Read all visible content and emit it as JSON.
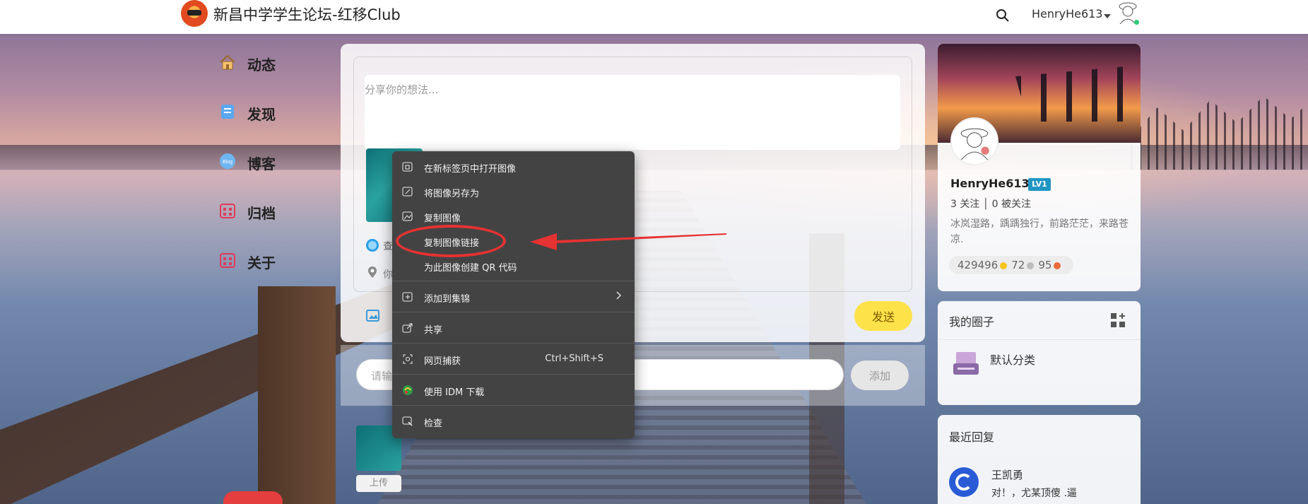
{
  "header": {
    "site_title": "新昌中学学生论坛-红移Club",
    "username": "HenryHe613"
  },
  "nav": {
    "items": [
      {
        "label": "动态",
        "icon": "home-icon"
      },
      {
        "label": "发现",
        "icon": "discover-icon"
      },
      {
        "label": "博客",
        "icon": "blog-icon"
      },
      {
        "label": "归档",
        "icon": "archive-icon"
      },
      {
        "label": "关于",
        "icon": "about-icon"
      }
    ]
  },
  "composer": {
    "placeholder": "分享你的想法...",
    "visibility_text": "查",
    "location_text": "你",
    "send_label": "发送"
  },
  "tags": {
    "input_placeholder": "请输",
    "add_label": "添加"
  },
  "post": {
    "upload_label": "上传"
  },
  "context_menu": {
    "items": [
      {
        "label": "在新标签页中打开图像",
        "icon": "open-tab-icon"
      },
      {
        "label": "将图像另存为",
        "icon": "save-image-icon"
      },
      {
        "label": "复制图像",
        "icon": "copy-image-icon"
      },
      {
        "label": "复制图像链接",
        "icon": ""
      },
      {
        "label": "为此图像创建 QR 代码",
        "icon": ""
      },
      {
        "label": "添加到集锦",
        "icon": "collection-icon"
      },
      {
        "label": "共享",
        "icon": "share-icon"
      },
      {
        "label": "网页捕获",
        "icon": "capture-icon",
        "shortcut": "Ctrl+Shift+S"
      },
      {
        "label": "使用 IDM 下载",
        "icon": "idm-icon"
      },
      {
        "label": "检查",
        "icon": "inspect-icon"
      }
    ],
    "highlighted": "复制图像链接"
  },
  "profile": {
    "name": "HenryHe613",
    "level": "LV1",
    "follow_text": "3 关注 │ 0 被关注",
    "bio": "冰岚湿路，踽踽独行，前路茫茫，来路苍凉.",
    "stats": [
      "429496",
      "72",
      "95"
    ],
    "colors": {
      "level_badge": "#2196c4"
    }
  },
  "circles": {
    "title": "我的圈子",
    "category": "默认分类"
  },
  "replies": {
    "title": "最近回复",
    "name": "王凯勇",
    "text": "对！，尤某顶傻 .逼"
  },
  "colors": {
    "send_button": "#fde24a",
    "context_menu_bg": "#434343",
    "highlight": "#e53232"
  }
}
